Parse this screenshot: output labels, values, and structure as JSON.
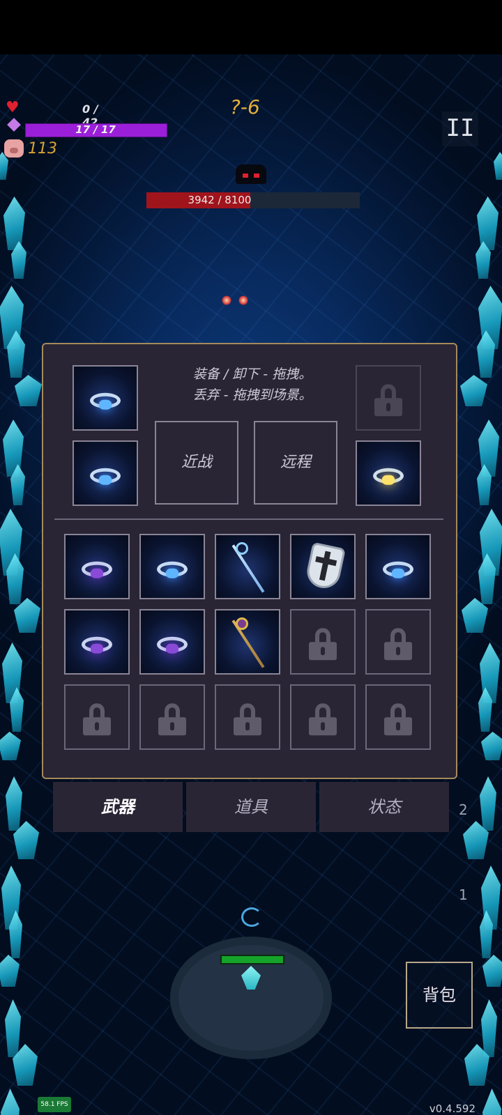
{
  "hud": {
    "hp": "0 / 42",
    "mp": "17 / 17",
    "mp_fraction": 1.0,
    "coins": "113",
    "level": "?-6",
    "pause_symbol": "II"
  },
  "boss": {
    "hp_text": "3942 / 8100",
    "hp_fraction": 0.487
  },
  "inventory": {
    "hint_line1": "装备 / 卸下 - 拖拽。",
    "hint_line2": "丢弃 - 拖拽到场景。",
    "melee_label": "近战",
    "ranged_label": "远程",
    "equipped_left": [
      {
        "item": "ring-blue-icon"
      },
      {
        "item": "ring-blue-cross-icon"
      }
    ],
    "equipped_right": [
      {
        "item": "lock-icon"
      },
      {
        "item": "ring-yellow-icon"
      }
    ],
    "grid": [
      [
        "ring-purple-icon",
        "ring-blue-icon",
        "staff-blue-icon",
        "shield-icon",
        "ring-blue-cross-icon"
      ],
      [
        "ring-purple-icon",
        "ring-purple-icon",
        "staff-gold-icon",
        "lock-icon",
        "lock-icon"
      ],
      [
        "lock-icon",
        "lock-icon",
        "lock-icon",
        "lock-icon",
        "lock-icon"
      ]
    ]
  },
  "tabs": [
    {
      "label": "武器",
      "active": true
    },
    {
      "label": "道具",
      "active": false
    },
    {
      "label": "状态",
      "active": false
    }
  ],
  "side": {
    "count_top": "2",
    "count_bottom": "1"
  },
  "bag_label": "背包",
  "fps": "58.1 FPS",
  "version": "v0.4.592",
  "colors": {
    "mp_bar": "#9b1fd8",
    "boss_bar": "#a0141c",
    "panel_bg": "#2a2535",
    "panel_border": "#a58a5a",
    "level_text": "#e3b03c",
    "coin_text": "#d6a532"
  }
}
